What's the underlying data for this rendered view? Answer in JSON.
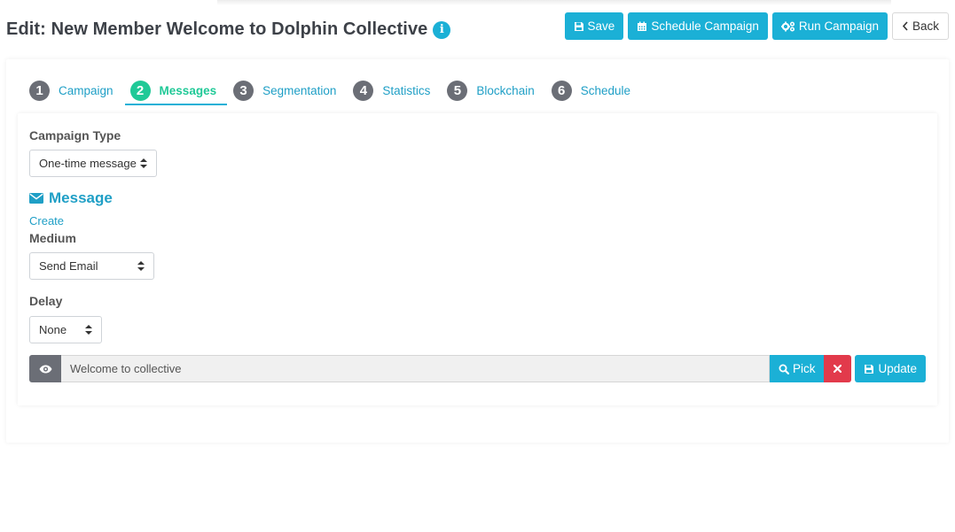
{
  "header": {
    "title": "Edit: New Member Welcome to Dolphin Collective",
    "info_icon": "info-icon",
    "actions": {
      "save": "Save",
      "schedule": "Schedule Campaign",
      "run": "Run Campaign",
      "back": "Back"
    }
  },
  "tabs": [
    {
      "num": "1",
      "label": "Campaign"
    },
    {
      "num": "2",
      "label": "Messages",
      "active": true
    },
    {
      "num": "3",
      "label": "Segmentation"
    },
    {
      "num": "4",
      "label": "Statistics"
    },
    {
      "num": "5",
      "label": "Blockchain"
    },
    {
      "num": "6",
      "label": "Schedule"
    }
  ],
  "form": {
    "campaign_type_label": "Campaign Type",
    "campaign_type_value": "One-time message",
    "message_heading": "Message",
    "create_link": "Create",
    "medium_label": "Medium",
    "medium_value": "Send Email",
    "delay_label": "Delay",
    "delay_value": "None",
    "message_value": "Welcome to collective",
    "pick_label": "Pick",
    "update_label": "Update"
  },
  "colors": {
    "primary": "#1bb0d6",
    "active_tab": "#20c997",
    "danger": "#e23a4b",
    "tab_number": "#6b6e76"
  }
}
